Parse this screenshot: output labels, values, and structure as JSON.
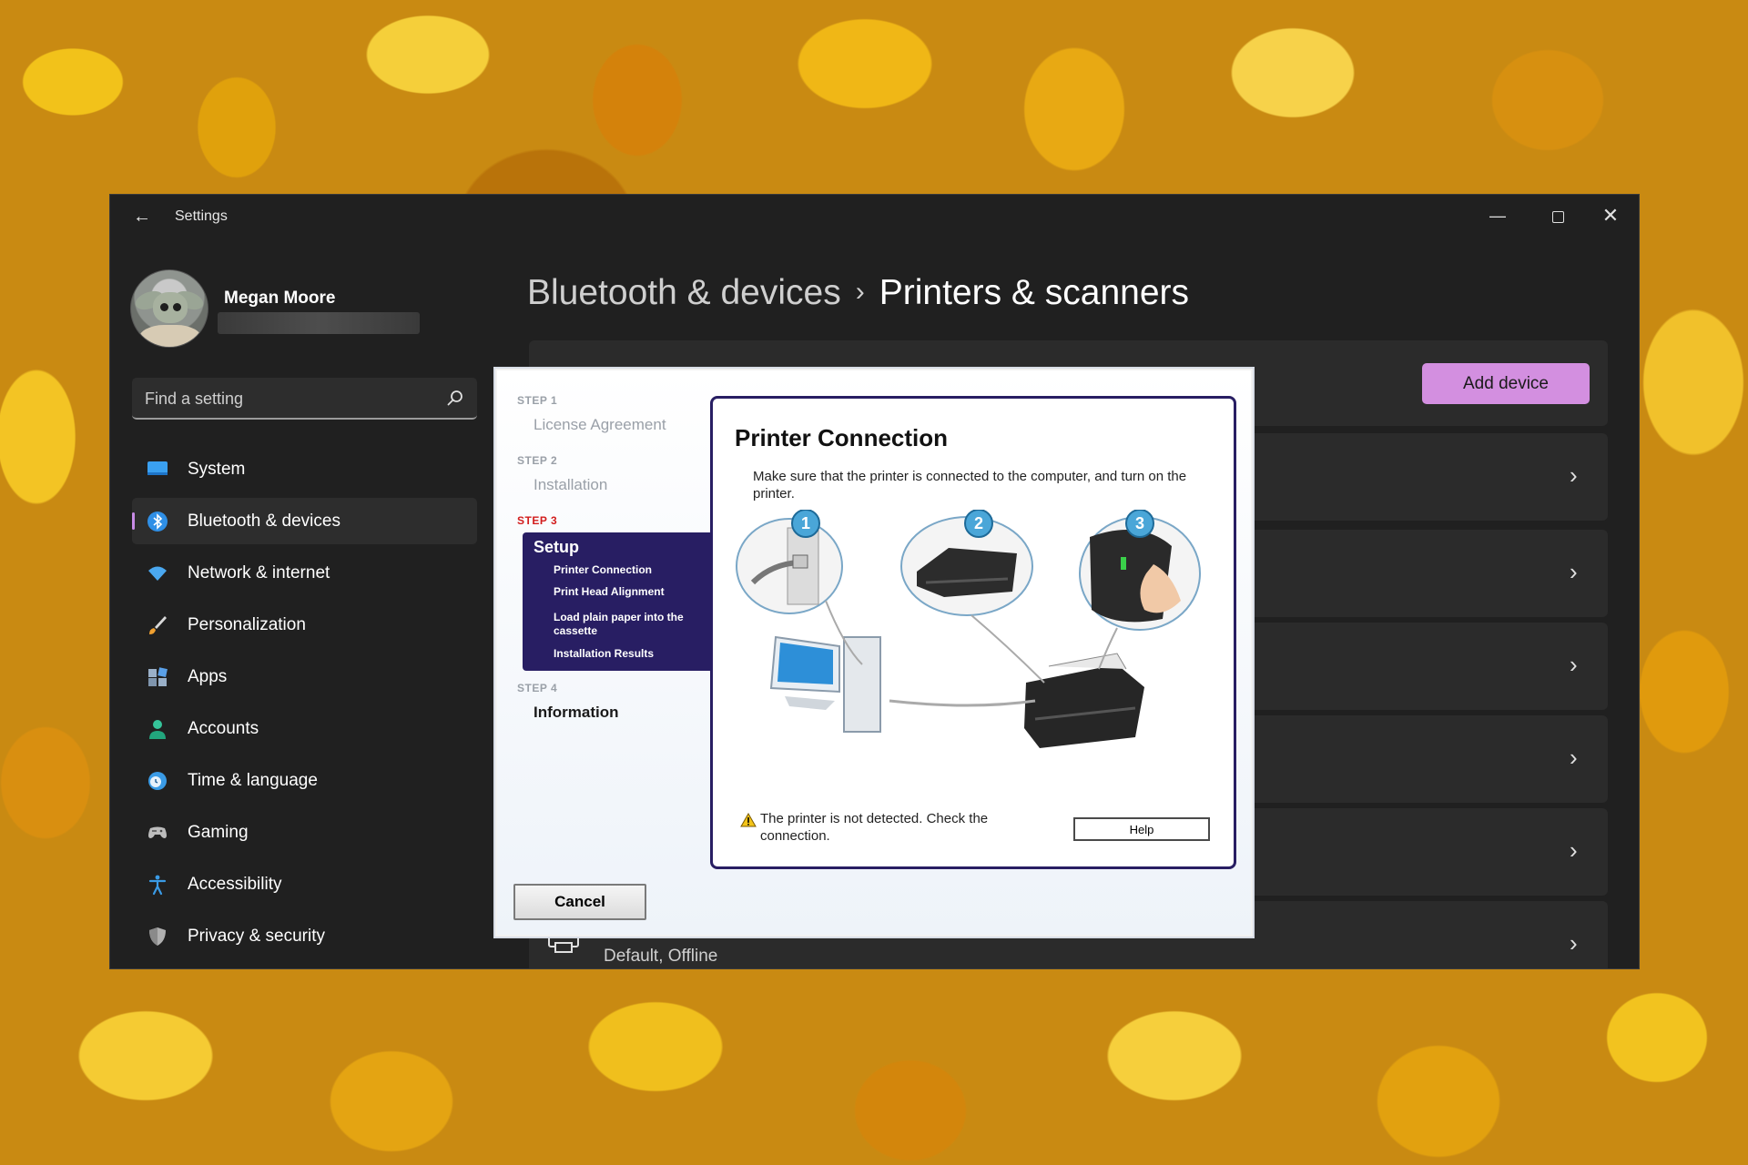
{
  "window": {
    "app_title": "Settings",
    "controls": {
      "minimize": "—",
      "close": "✕"
    }
  },
  "user": {
    "name": "Megan Moore"
  },
  "search": {
    "placeholder": "Find a setting"
  },
  "nav": {
    "items": [
      {
        "label": "System",
        "icon": "monitor-icon",
        "active": false
      },
      {
        "label": "Bluetooth & devices",
        "icon": "bluetooth-icon",
        "active": true
      },
      {
        "label": "Network & internet",
        "icon": "wifi-icon",
        "active": false
      },
      {
        "label": "Personalization",
        "icon": "brush-icon",
        "active": false
      },
      {
        "label": "Apps",
        "icon": "apps-icon",
        "active": false
      },
      {
        "label": "Accounts",
        "icon": "person-icon",
        "active": false
      },
      {
        "label": "Time & language",
        "icon": "globe-clock-icon",
        "active": false
      },
      {
        "label": "Gaming",
        "icon": "gamepad-icon",
        "active": false
      },
      {
        "label": "Accessibility",
        "icon": "accessibility-icon",
        "active": false
      },
      {
        "label": "Privacy & security",
        "icon": "shield-icon",
        "active": false
      }
    ]
  },
  "breadcrumb": {
    "parent": "Bluetooth & devices",
    "separator": "›",
    "current": "Printers & scanners"
  },
  "add_device": {
    "label": "Add device"
  },
  "devices": {
    "last_status": "Default, Offline",
    "chevron": "›"
  },
  "dialog": {
    "steps": [
      {
        "label": "STEP 1",
        "title": "License Agreement"
      },
      {
        "label": "STEP 2",
        "title": "Installation"
      },
      {
        "label": "STEP 3",
        "title": "Setup"
      },
      {
        "label": "STEP 4",
        "title": "Information"
      }
    ],
    "setup_substeps": [
      "Printer Connection",
      "Print Head Alignment",
      "Load plain paper into the cassette",
      "Installation Results"
    ],
    "title": "Printer Connection",
    "description": "Make sure that the printer is connected to the computer, and turn on the printer.",
    "callouts": [
      "1",
      "2",
      "3"
    ],
    "warning": "The printer is not detected. Check the connection.",
    "help_label": "Help",
    "cancel_label": "Cancel"
  },
  "colors": {
    "accent": "#d38fe0",
    "window_bg": "#202020",
    "panel_bg": "#2b2b2b",
    "dialog_nav": "#281e63",
    "step_current": "#d21d1d"
  }
}
